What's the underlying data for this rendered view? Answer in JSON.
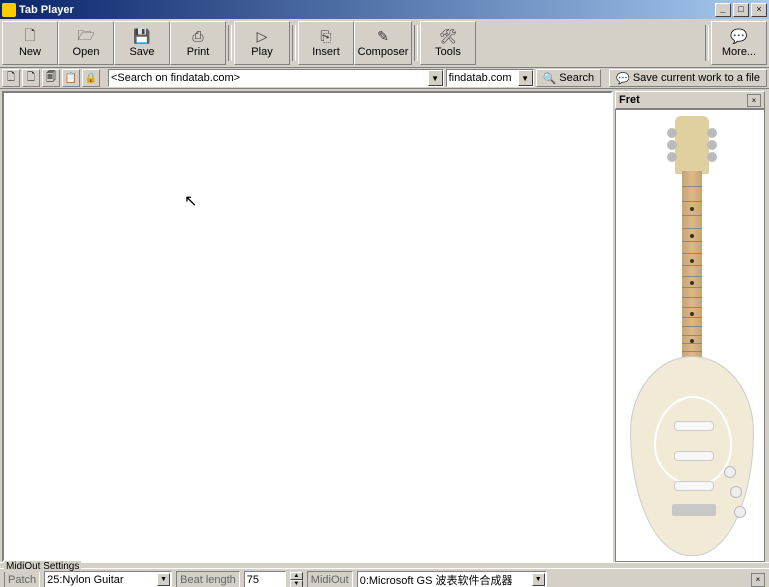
{
  "window": {
    "title": "Tab Player"
  },
  "toolbar": {
    "new": "New",
    "open": "Open",
    "save": "Save",
    "print": "Print",
    "play": "Play",
    "insert": "Insert",
    "composer": "Composer",
    "tools": "Tools",
    "more": "More..."
  },
  "search": {
    "placeholder": "<Search on findatab.com>",
    "domain": "findatab.com",
    "button": "Search",
    "save_work": "Save current work to a file"
  },
  "fret": {
    "title": "Fret"
  },
  "midi": {
    "legend": "MidiOut Settings",
    "patch_label": "Patch",
    "patch_value": "25:Nylon Guitar",
    "beat_label": "Beat length",
    "beat_value": "75",
    "out_label": "MidiOut",
    "out_value": "0:Microsoft GS 波表软件合成器"
  }
}
